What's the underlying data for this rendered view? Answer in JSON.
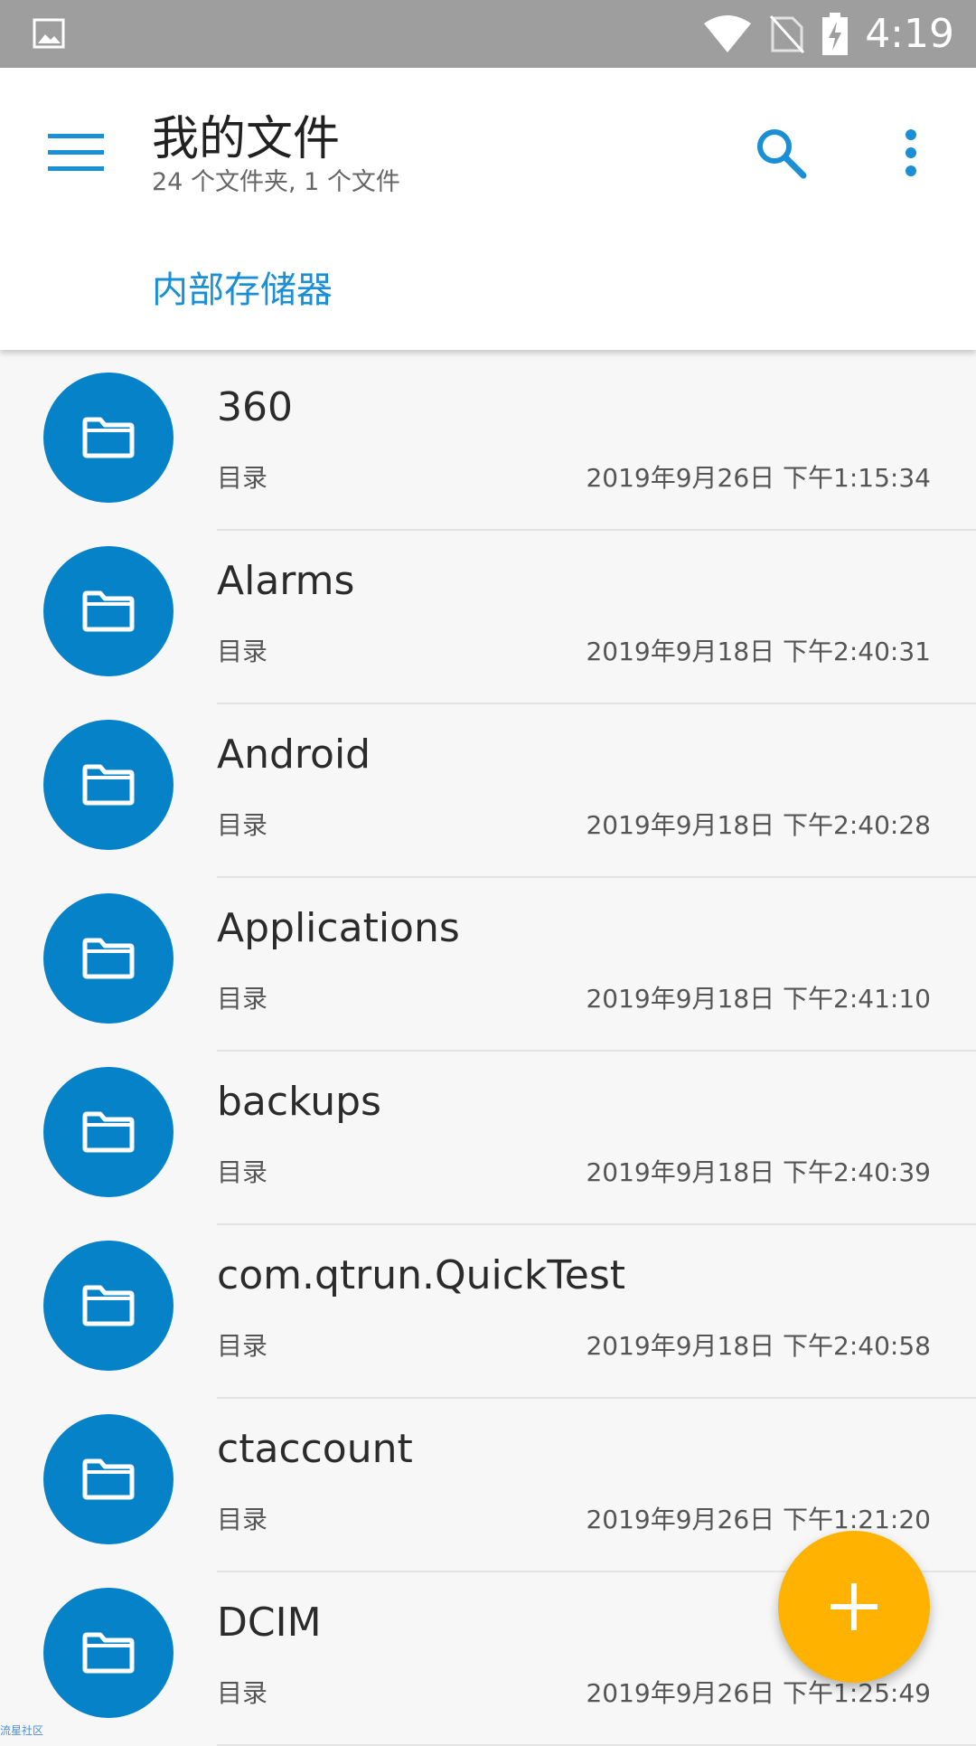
{
  "status_bar": {
    "time": "4:19",
    "icons": [
      "image-notification-icon",
      "wifi-icon",
      "no-sim-icon",
      "battery-charging-icon"
    ]
  },
  "header": {
    "title": "我的文件",
    "subtitle": "24 个文件夹, 1 个文件",
    "breadcrumb": "内部存储器",
    "accent_color": "#1a8fd6"
  },
  "files": [
    {
      "name": "360",
      "type": "目录",
      "modified": "2019年9月26日 下午1:15:34"
    },
    {
      "name": "Alarms",
      "type": "目录",
      "modified": "2019年9月18日 下午2:40:31"
    },
    {
      "name": "Android",
      "type": "目录",
      "modified": "2019年9月18日 下午2:40:28"
    },
    {
      "name": "Applications",
      "type": "目录",
      "modified": "2019年9月18日 下午2:41:10"
    },
    {
      "name": "backups",
      "type": "目录",
      "modified": "2019年9月18日 下午2:40:39"
    },
    {
      "name": "com.qtrun.QuickTest",
      "type": "目录",
      "modified": "2019年9月18日 下午2:40:58"
    },
    {
      "name": "ctaccount",
      "type": "目录",
      "modified": "2019年9月26日 下午1:21:20"
    },
    {
      "name": "DCIM",
      "type": "目录",
      "modified": "2019年9月26日 下午1:25:49"
    }
  ],
  "colors": {
    "folder_circle": "#0582c8",
    "fab": "#ffb300",
    "status_bar": "#9e9e9e"
  },
  "watermark": "流星社区"
}
